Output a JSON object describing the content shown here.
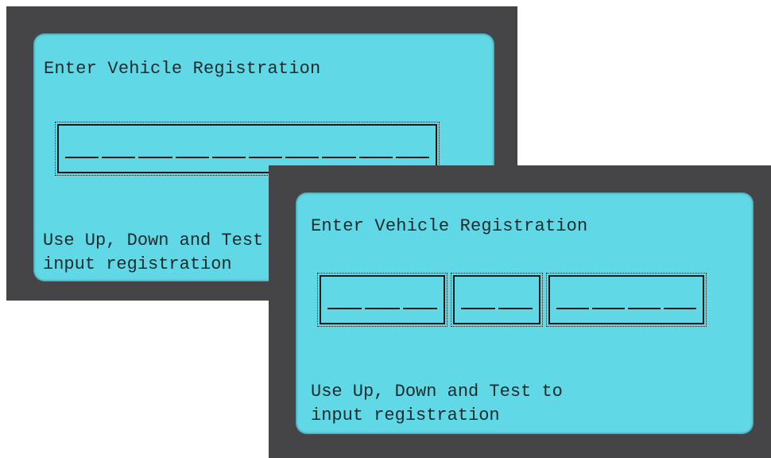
{
  "screens": [
    {
      "title": "Enter Vehicle Registration",
      "instructions": [
        "Use Up, Down and Test to",
        "input registration"
      ],
      "segments": [
        10
      ]
    },
    {
      "title": "Enter Vehicle Registration",
      "instructions": [
        "Use Up, Down and Test to",
        "input registration"
      ],
      "segments": [
        3,
        2,
        4
      ]
    }
  ],
  "colors": {
    "bezel": "#454547",
    "lcd": "#61d8e6",
    "text": "#1e2a2c"
  }
}
